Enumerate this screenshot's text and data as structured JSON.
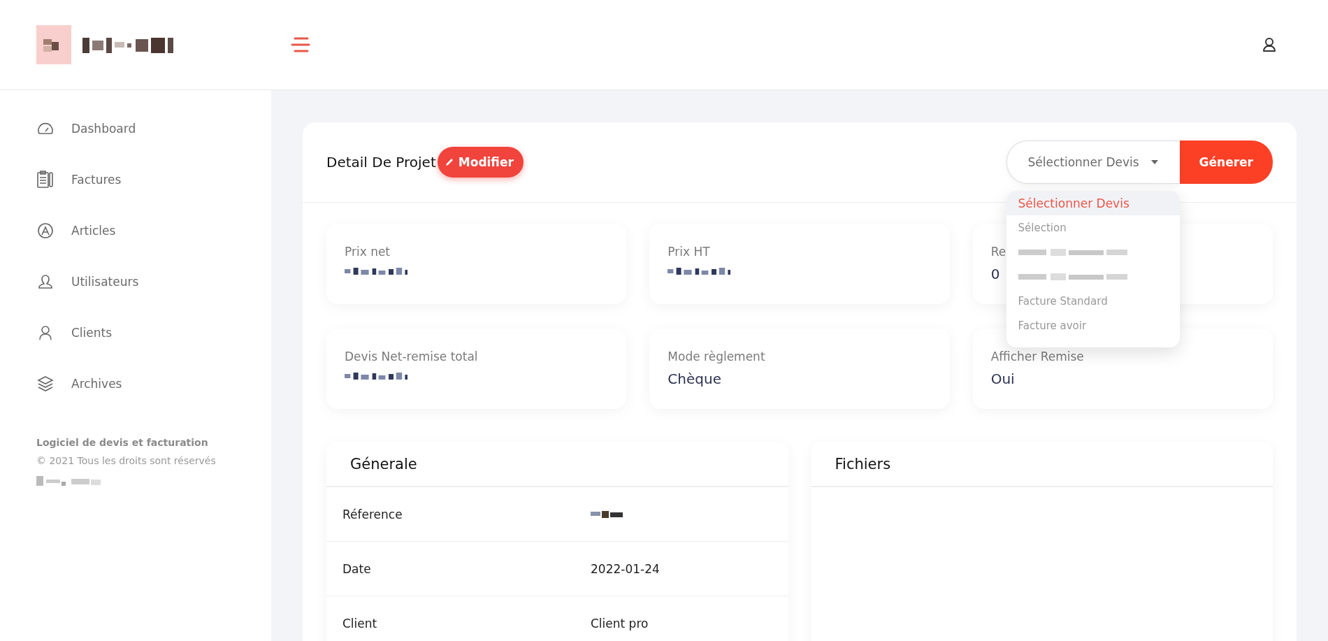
{
  "header": {
    "logo": {
      "kind": "pixelated"
    }
  },
  "sidebar": {
    "items": [
      {
        "label": "Dashboard",
        "selected": false
      },
      {
        "label": "Factures",
        "selected": false
      },
      {
        "label": "Articles",
        "selected": false
      },
      {
        "label": "Utilisateurs",
        "selected": false
      },
      {
        "label": "Clients",
        "selected": false
      },
      {
        "label": "Archives",
        "selected": false
      }
    ],
    "footer": {
      "title": "Logiciel de devis et facturation",
      "copyright": "© 2021 Tous les droits sont réservés",
      "credit": {
        "kind": "pixelated"
      }
    }
  },
  "project": {
    "title": "Detail De Projet",
    "edit_button": "Modifier",
    "devis_select": {
      "value": "Sélectionner Devis",
      "expanded": true,
      "options": [
        {
          "kind": "text",
          "label": "Sélectionner Devis",
          "selected": true
        },
        {
          "kind": "text",
          "label": "Sélection",
          "selected": false
        },
        {
          "kind": "pixelated",
          "selected": false
        },
        {
          "kind": "pixelated",
          "selected": false
        },
        {
          "kind": "text",
          "label": "Facture Standard",
          "selected": false
        },
        {
          "kind": "text",
          "label": "Facture avoir",
          "selected": false
        }
      ]
    },
    "generate_button": "Génerer",
    "stats": [
      {
        "label": "Prix net",
        "kind": "pixelated"
      },
      {
        "label": "Prix HT",
        "kind": "pixelated"
      },
      {
        "label": "Re",
        "kind": "text",
        "value": "0"
      },
      {
        "label": "Devis Net-remise total",
        "kind": "pixelated"
      },
      {
        "label": "Mode règlement",
        "kind": "text",
        "value": "Chèque"
      },
      {
        "label": "Afficher Remise",
        "kind": "text",
        "value": "Oui"
      }
    ]
  },
  "general": {
    "title": "Génerale",
    "rows": [
      {
        "label": "Réference",
        "kind": "pixelated"
      },
      {
        "label": "Date",
        "kind": "text",
        "value": "2022-01-24"
      },
      {
        "label": "Client",
        "kind": "text",
        "value": "Client pro"
      }
    ]
  },
  "files": {
    "title": "Fichiers"
  }
}
